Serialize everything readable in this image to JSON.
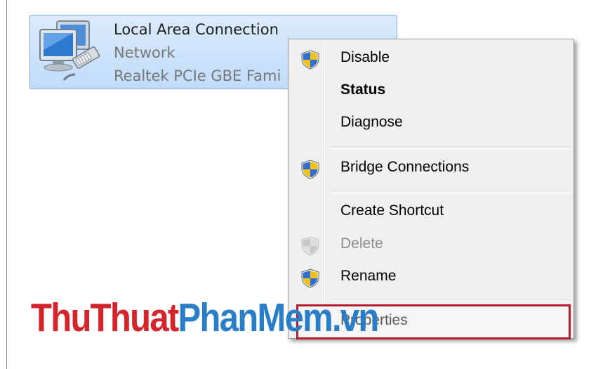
{
  "connection": {
    "name": "Local Area Connection",
    "network": "Network",
    "adapter": "Realtek PCIe GBE Fami",
    "icon": "network-connection-icon"
  },
  "context_menu": {
    "items": [
      {
        "label": "Disable",
        "icon": "uac-shield-icon",
        "style": "normal"
      },
      {
        "label": "Status",
        "icon": null,
        "style": "bold"
      },
      {
        "label": "Diagnose",
        "icon": null,
        "style": "normal"
      },
      {
        "label": "Bridge Connections",
        "icon": "uac-shield-icon",
        "style": "normal"
      },
      {
        "label": "Create Shortcut",
        "icon": null,
        "style": "normal"
      },
      {
        "label": "Delete",
        "icon": "uac-shield-icon",
        "style": "disabled"
      },
      {
        "label": "Rename",
        "icon": "uac-shield-icon",
        "style": "normal"
      },
      {
        "label": "Properties",
        "icon": null,
        "style": "normal"
      }
    ]
  },
  "watermark": {
    "part1": "ThuThuat",
    "part2": "PhanMem.vn"
  },
  "colors": {
    "selection_bg": "#c1dcfc",
    "menu_bg": "#f0f0f0",
    "highlight_border": "#b51d2c",
    "watermark_red": "#d3252b",
    "watermark_blue": "#2a7ec8"
  }
}
